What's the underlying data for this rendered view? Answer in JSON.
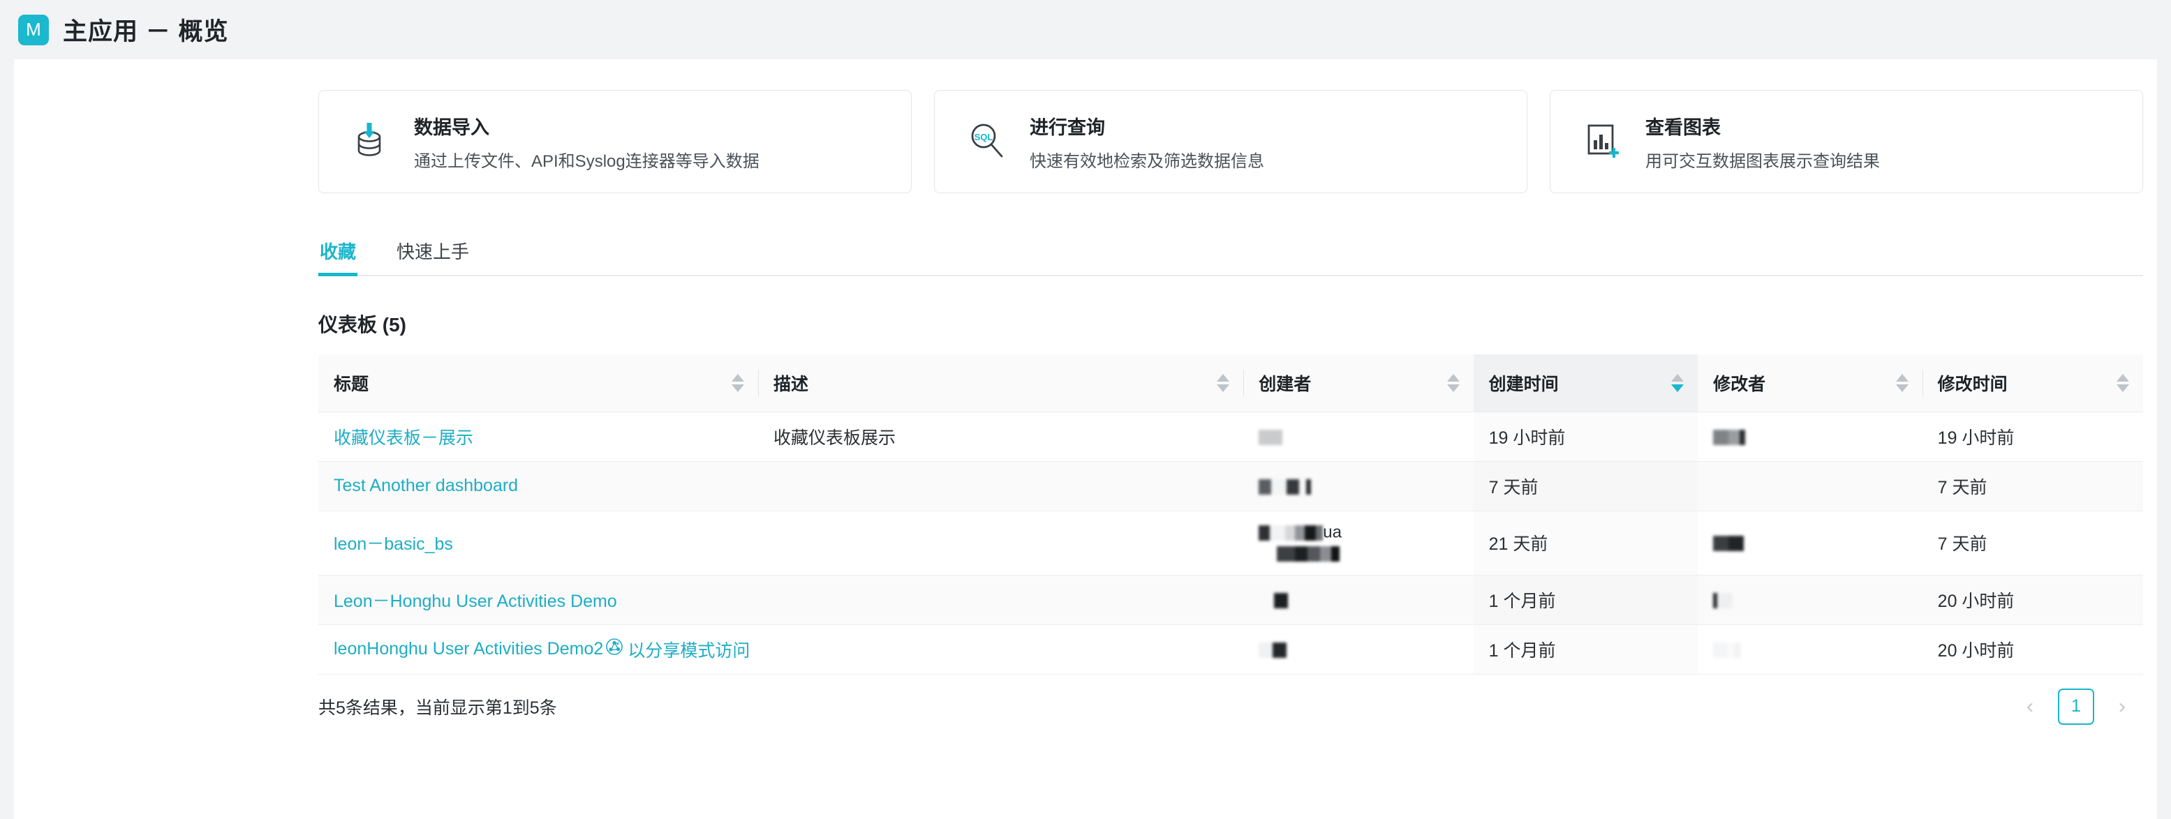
{
  "app": {
    "logo_letter": "M",
    "title": "主应用 －  概览",
    "accent_color": "#19b6cc",
    "page_bg": "#f2f3f5"
  },
  "cards": [
    {
      "icon": "database-import-icon",
      "title": "数据导入",
      "desc": "通过上传文件、API和Syslog连接器等导入数据"
    },
    {
      "icon": "sql-search-icon",
      "title": "进行查询",
      "desc": "快速有效地检索及筛选数据信息"
    },
    {
      "icon": "chart-add-icon",
      "title": "查看图表",
      "desc": "用可交互数据图表展示查询结果"
    }
  ],
  "tabs": [
    {
      "label": "收藏",
      "active": true
    },
    {
      "label": "快速上手",
      "active": false
    }
  ],
  "section": {
    "title": "仪表板 (5)"
  },
  "table": {
    "columns": [
      {
        "key": "title",
        "label": "标题",
        "sort": "none"
      },
      {
        "key": "desc",
        "label": "描述",
        "sort": "none"
      },
      {
        "key": "creator",
        "label": "创建者",
        "sort": "none"
      },
      {
        "key": "ctime",
        "label": "创建时间",
        "sort": "desc"
      },
      {
        "key": "modifier",
        "label": "修改者",
        "sort": "none"
      },
      {
        "key": "mtime",
        "label": "修改时间",
        "sort": "none"
      }
    ],
    "rows": [
      {
        "title": "收藏仪表板－展示",
        "title_icon": "",
        "title_suffix": "",
        "desc": "收藏仪表板展示",
        "creator": "",
        "creator_tail": "",
        "ctime": "19 小时前",
        "modifier": "",
        "modifier_tail": "",
        "mtime": "19 小时前"
      },
      {
        "title": "Test Another dashboard",
        "title_icon": "",
        "title_suffix": "",
        "desc": "",
        "creator": "",
        "creator_tail": "",
        "ctime": "7 天前",
        "modifier": "",
        "modifier_tail": "",
        "mtime": "7 天前"
      },
      {
        "title": "leon－basic_bs",
        "title_icon": "",
        "title_suffix": "",
        "desc": "",
        "creator": "",
        "creator_tail": "ua",
        "ctime": "21 天前",
        "modifier": "",
        "modifier_tail": "",
        "mtime": "7 天前"
      },
      {
        "title": "Leon－Honghu User Activities Demo",
        "title_icon": "",
        "title_suffix": "",
        "desc": "",
        "creator": "",
        "creator_tail": "",
        "ctime": "1 个月前",
        "modifier": "",
        "modifier_tail": "",
        "mtime": "20 小时前"
      },
      {
        "title": "leonHonghu User Activities Demo2",
        "title_icon": "share-icon",
        "title_suffix": "以分享模式访问",
        "desc": "",
        "creator": "",
        "creator_tail": "",
        "ctime": "1 个月前",
        "modifier": "",
        "modifier_tail": "",
        "mtime": "20 小时前"
      }
    ]
  },
  "footer": {
    "result_text": "共5条结果，当前显示第1到5条",
    "prev_label": "‹",
    "next_label": "›",
    "current_page": "1"
  }
}
